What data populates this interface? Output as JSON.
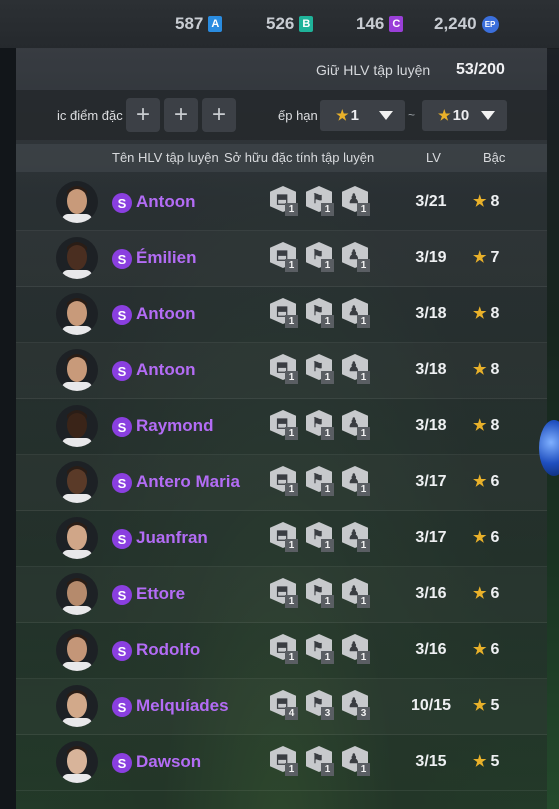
{
  "currency": [
    {
      "value": "587",
      "icon": "A"
    },
    {
      "value": "526",
      "icon": "B"
    },
    {
      "value": "146",
      "icon": "C"
    },
    {
      "value": "2,240",
      "icon": "EP"
    }
  ],
  "limit": {
    "label": "Giữ HLV tập luyện",
    "value": "53/200"
  },
  "filter": {
    "traits_label": "ic điểm đặc",
    "plus": "+",
    "rank_label": "ếp hạn",
    "rank_min": "1",
    "rank_max": "10",
    "separator": "~"
  },
  "columns": {
    "name": "Tên HLV tập luyện",
    "traits": "Sở hữu đặc tính tập luyện",
    "lv": "LV",
    "rank": "Bậc"
  },
  "rows": [
    {
      "name": "Antoon",
      "lv": "3/21",
      "rank": "8",
      "traits": [
        "1",
        "1",
        "1"
      ],
      "skin": "#c89a7a"
    },
    {
      "name": "Émilien",
      "lv": "3/19",
      "rank": "7",
      "traits": [
        "1",
        "1",
        "1"
      ],
      "skin": "#4a2e20"
    },
    {
      "name": "Antoon",
      "lv": "3/18",
      "rank": "8",
      "traits": [
        "1",
        "1",
        "1"
      ],
      "skin": "#c89a7a"
    },
    {
      "name": "Antoon",
      "lv": "3/18",
      "rank": "8",
      "traits": [
        "1",
        "1",
        "1"
      ],
      "skin": "#c89a7a"
    },
    {
      "name": "Raymond",
      "lv": "3/18",
      "rank": "8",
      "traits": [
        "1",
        "1",
        "1"
      ],
      "skin": "#3a2418"
    },
    {
      "name": "Antero Maria",
      "lv": "3/17",
      "rank": "6",
      "traits": [
        "1",
        "1",
        "1"
      ],
      "skin": "#5a3a28"
    },
    {
      "name": "Juanfran",
      "lv": "3/17",
      "rank": "6",
      "traits": [
        "1",
        "1",
        "1"
      ],
      "skin": "#d0a688"
    },
    {
      "name": "Ettore",
      "lv": "3/16",
      "rank": "6",
      "traits": [
        "1",
        "1",
        "1"
      ],
      "skin": "#b58a6c"
    },
    {
      "name": "Rodolfo",
      "lv": "3/16",
      "rank": "6",
      "traits": [
        "1",
        "1",
        "1"
      ],
      "skin": "#c49678"
    },
    {
      "name": "Melquíades",
      "lv": "10/15",
      "rank": "5",
      "traits": [
        "4",
        "3",
        "3"
      ],
      "skin": "#d2a98a"
    },
    {
      "name": "Dawson",
      "lv": "3/15",
      "rank": "5",
      "traits": [
        "1",
        "1",
        "1"
      ],
      "skin": "#d8b49a"
    }
  ]
}
